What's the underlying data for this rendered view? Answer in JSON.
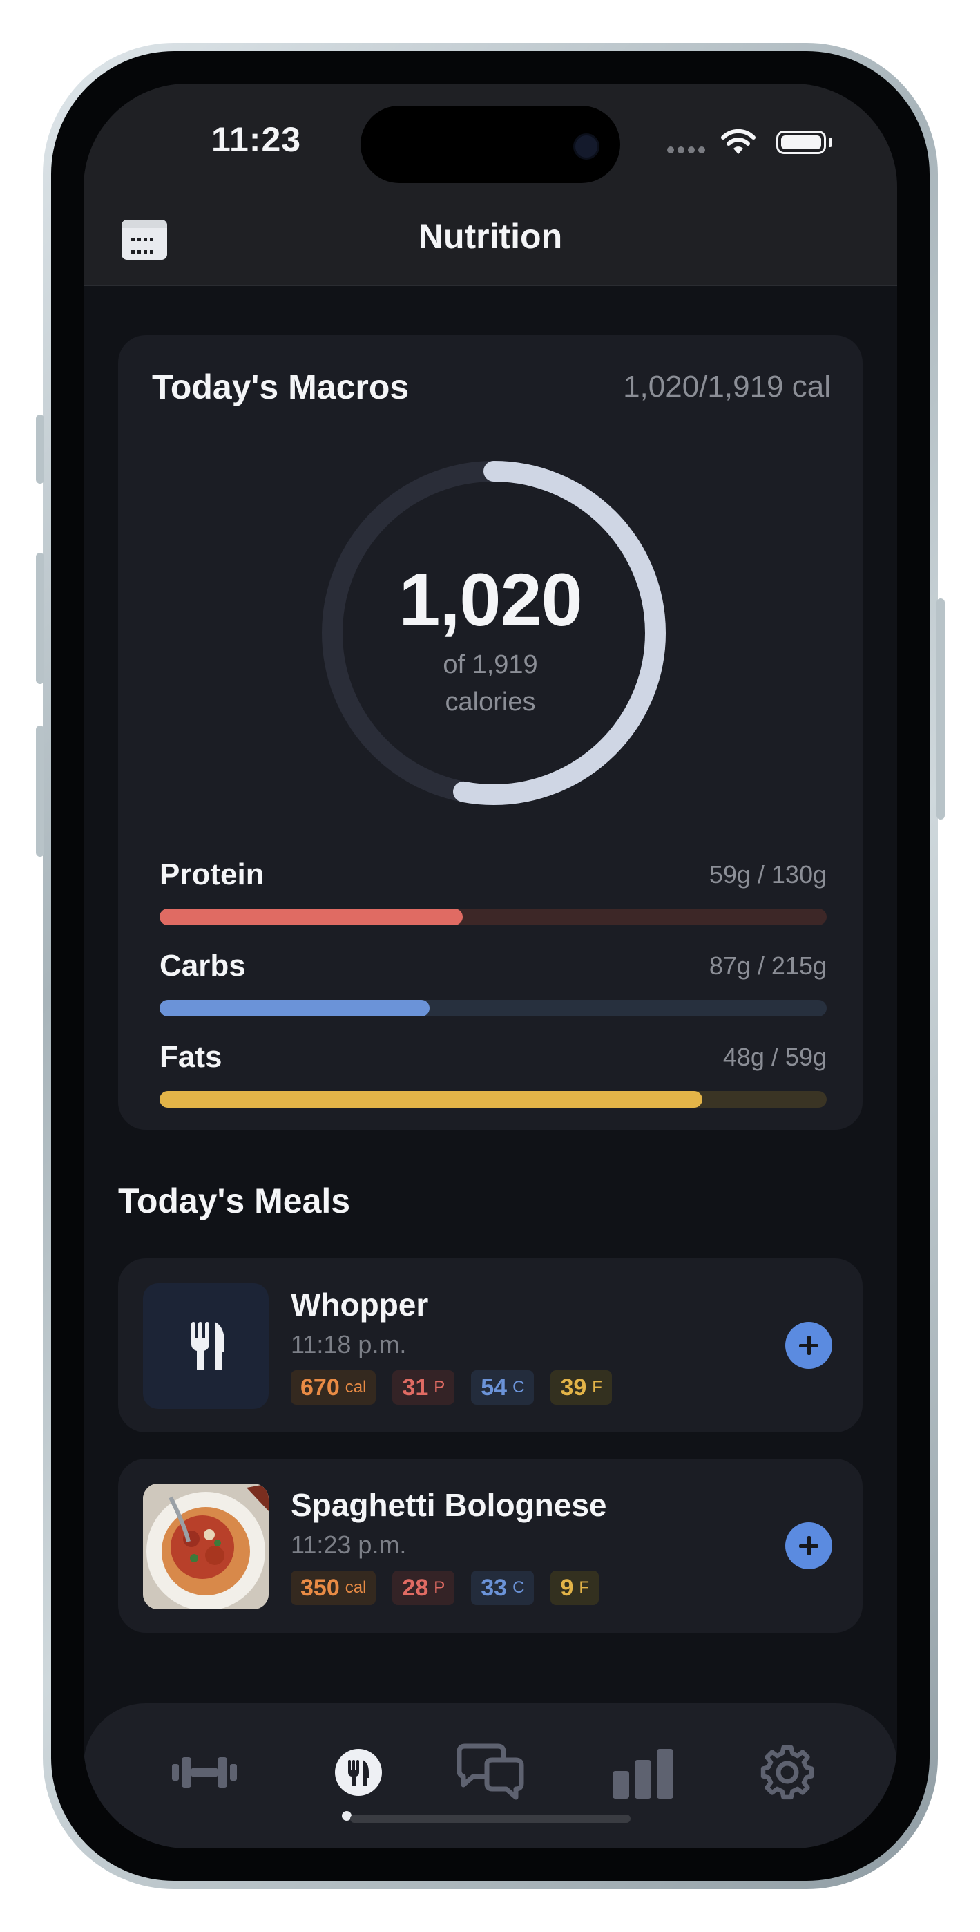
{
  "status_bar": {
    "time": "11:23"
  },
  "header": {
    "title": "Nutrition",
    "calendar_icon": "calendar-icon"
  },
  "macros": {
    "title": "Today's Macros",
    "total_text": "1,020/1,919 cal",
    "calories_value": "1,020",
    "calories_of": "of 1,919",
    "calories_unit": "calories",
    "progress_fraction": 0.53,
    "rows": [
      {
        "name": "Protein",
        "amount": "59g / 130g",
        "fraction": 0.454,
        "color": "#e06b63",
        "track": "#3d2727"
      },
      {
        "name": "Carbs",
        "amount": "87g / 215g",
        "fraction": 0.405,
        "color": "#6b93d8",
        "track": "#27303e"
      },
      {
        "name": "Fats",
        "amount": "48g / 59g",
        "fraction": 0.814,
        "color": "#e3b448",
        "track": "#3a3424"
      }
    ]
  },
  "meals": {
    "title": "Today's Meals",
    "items": [
      {
        "name": "Whopper",
        "time": "11:18 p.m.",
        "thumb_icon": "fork-knife-icon",
        "chips": [
          {
            "value": "670",
            "unit": "cal"
          },
          {
            "value": "31",
            "unit": "P"
          },
          {
            "value": "54",
            "unit": "C"
          },
          {
            "value": "39",
            "unit": "F"
          }
        ]
      },
      {
        "name": "Spaghetti Bolognese",
        "time": "11:23 p.m.",
        "thumb_icon": "spaghetti-photo",
        "chips": [
          {
            "value": "350",
            "unit": "cal"
          },
          {
            "value": "28",
            "unit": "P"
          },
          {
            "value": "33",
            "unit": "C"
          },
          {
            "value": "9",
            "unit": "F"
          }
        ]
      }
    ]
  },
  "tabbar": {
    "tabs": [
      {
        "icon": "dumbbell-icon",
        "active": false
      },
      {
        "icon": "fork-knife-icon",
        "active": true
      },
      {
        "icon": "chat-bubbles-icon",
        "active": false
      },
      {
        "icon": "bar-chart-icon",
        "active": false
      },
      {
        "icon": "gear-icon",
        "active": false
      }
    ]
  },
  "colors": {
    "accent": "#5b8be0",
    "cal_chip": "#e98b45",
    "protein_chip": "#e06b63",
    "carbs_chip": "#6b93d8",
    "fats_chip": "#e3b448"
  }
}
